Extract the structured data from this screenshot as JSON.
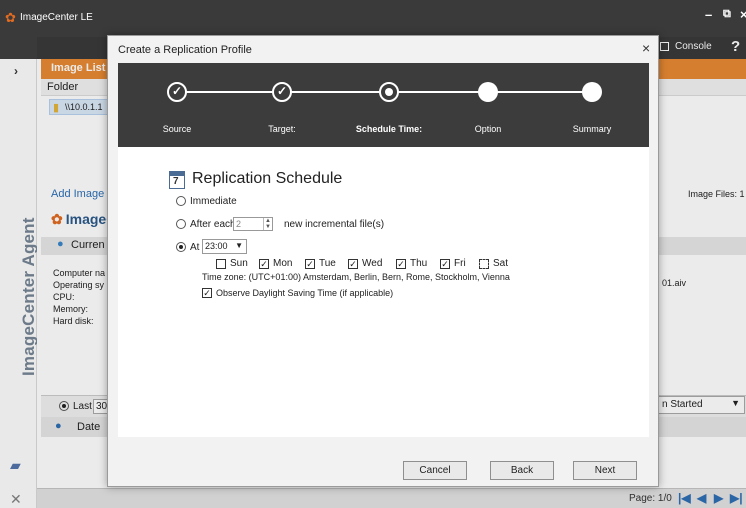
{
  "app": {
    "title": "ImageCenter LE",
    "minimize_glyph": "–",
    "restore_glyph": "⧉",
    "close_glyph": "×",
    "console_label": "Console",
    "help_glyph": "?",
    "rail_label": "ImageCenter Agent",
    "expand_glyph": "›"
  },
  "main": {
    "image_list_header": "Image List",
    "folder_column": "Folder",
    "folder_row": "\\\\10.0.1.1",
    "add_image": "Add Image",
    "image_files": "Image Files: 1",
    "section_title": "ImageC",
    "current_tab": "Curren",
    "info_labels": [
      "Computer na",
      "Operating sy",
      "CPU:",
      "Memory:",
      "Hard disk:"
    ],
    "info_file": "01.aiv",
    "last_label": "Last",
    "last_value": "30",
    "started_select": "n Started",
    "date_column": "Date",
    "page_label": "Page: 1/0"
  },
  "dialog": {
    "title": "Create a Replication Profile",
    "close_glyph": "×",
    "steps": [
      {
        "label": "Source",
        "state": "done"
      },
      {
        "label": "Target:",
        "state": "done"
      },
      {
        "label": "Schedule Time:",
        "state": "current"
      },
      {
        "label": "Option",
        "state": "todo"
      },
      {
        "label": "Summary",
        "state": "todo"
      }
    ],
    "check_glyph": "✓",
    "section_icon_number": "7",
    "section_title": "Replication Schedule",
    "option_immediate": "Immediate",
    "option_after_each": "After each",
    "after_each_value": "2",
    "after_each_suffix": "new incremental file(s)",
    "option_at": "At",
    "at_time": "23:00",
    "days": [
      {
        "label": "Sun",
        "checked": false
      },
      {
        "label": "Mon",
        "checked": true
      },
      {
        "label": "Tue",
        "checked": true
      },
      {
        "label": "Wed",
        "checked": true
      },
      {
        "label": "Thu",
        "checked": true
      },
      {
        "label": "Fri",
        "checked": true
      },
      {
        "label": "Sat",
        "checked": false
      }
    ],
    "timezone": "Time zone: (UTC+01:00) Amsterdam, Berlin, Bern, Rome, Stockholm, Vienna",
    "dst_label": "Observe Daylight Saving Time (if applicable)",
    "dst_checked": true,
    "cancel_label": "Cancel",
    "back_label": "Back",
    "next_label": "Next"
  },
  "colors": {
    "accent_orange": "#e98933",
    "title_bar": "#3a3a3a",
    "link_blue": "#2d6fb7"
  }
}
